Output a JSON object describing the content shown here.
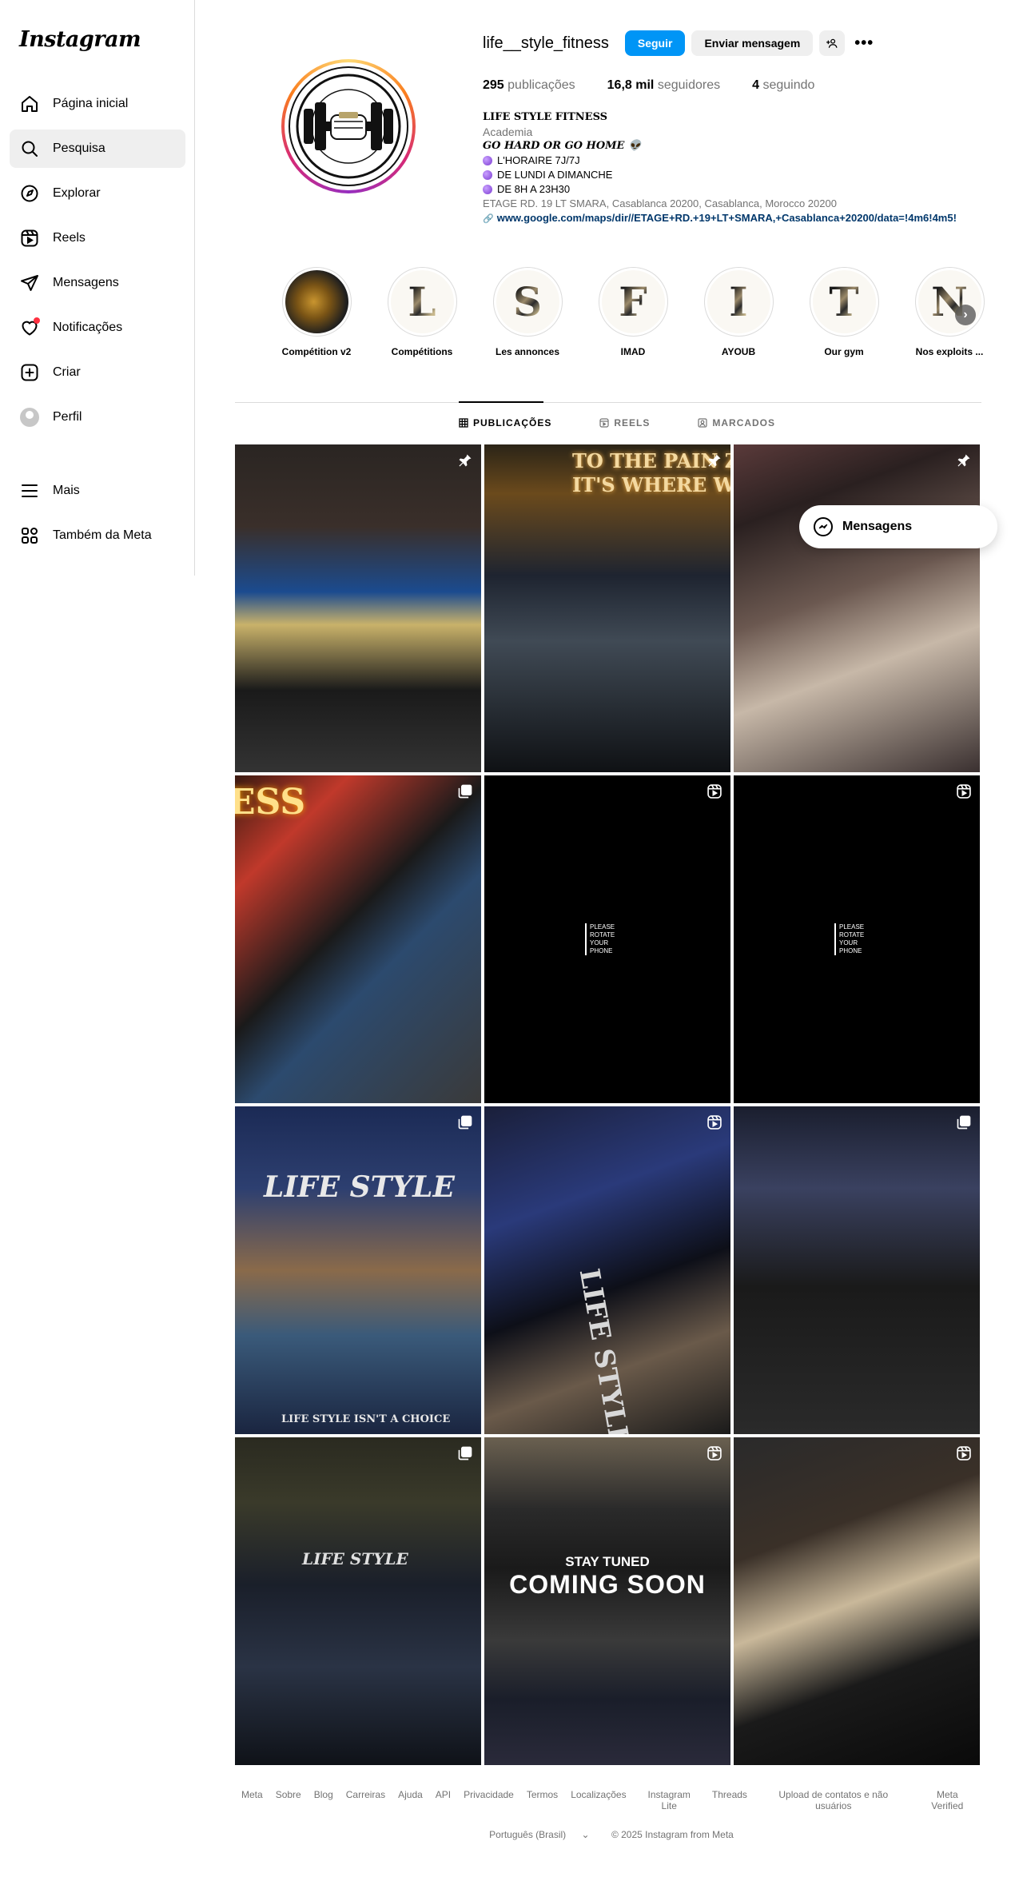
{
  "app": {
    "logo_text": "Instagram"
  },
  "sidebar": {
    "items": [
      {
        "label": "Página inicial",
        "icon": "home-icon"
      },
      {
        "label": "Pesquisa",
        "icon": "search-icon",
        "active": true
      },
      {
        "label": "Explorar",
        "icon": "compass-icon"
      },
      {
        "label": "Reels",
        "icon": "reels-icon"
      },
      {
        "label": "Mensagens",
        "icon": "direct-icon"
      },
      {
        "label": "Notificações",
        "icon": "heart-icon"
      },
      {
        "label": "Criar",
        "icon": "plus-square-icon"
      },
      {
        "label": "Perfil",
        "icon": "avatar"
      }
    ],
    "bottom_items": [
      {
        "label": "Mais",
        "icon": "menu-icon"
      },
      {
        "label": "Também da Meta",
        "icon": "meta-apps-icon"
      }
    ]
  },
  "profile": {
    "username": "life__style_fitness",
    "follow_button": "Seguir",
    "message_button": "Enviar mensagem",
    "stats": {
      "posts_value": "295",
      "posts_label": "publicações",
      "followers_value": "16,8 mil",
      "followers_label": "seguidores",
      "following_value": "4",
      "following_label": "seguindo"
    },
    "bio": {
      "name": "LIFE STYLE FITNESS",
      "category": "Academia",
      "line1": "GO HARD OR GO HOME 👽",
      "line2": "L'HORAIRE 7J/7J",
      "line3": "DE LUNDI A DIMANCHE",
      "line4": "DE 8H A 23H30",
      "address": "ETAGE RD. 19 LT SMARA, Casablanca 20200, Casablanca, Morocco 20200",
      "link": "www.google.com/maps/dir//ETAGE+RD.+19+LT+SMARA,+Casablanca+20200/data=!4m6!4m5!"
    }
  },
  "highlights": [
    {
      "label": "Compétition v2",
      "letter": ""
    },
    {
      "label": "Compétitions",
      "letter": "L"
    },
    {
      "label": "Les annonces",
      "letter": "S"
    },
    {
      "label": "IMAD",
      "letter": "F"
    },
    {
      "label": "AYOUB",
      "letter": "I"
    },
    {
      "label": "Our gym",
      "letter": "T"
    },
    {
      "label": "Nos exploits ...",
      "letter": "N"
    }
  ],
  "tabs": [
    {
      "label": "PUBLICAÇÕES",
      "icon": "grid-icon",
      "active": true
    },
    {
      "label": "REELS",
      "icon": "reels-icon"
    },
    {
      "label": "MARCADOS",
      "icon": "tagged-icon"
    }
  ],
  "posts": [
    {
      "type": "pinned"
    },
    {
      "type": "pinned",
      "neon1": "TO THE PAIN ZO",
      "neon2": "IT'S WHERE WE T"
    },
    {
      "type": "pinned"
    },
    {
      "type": "carousel",
      "neon": "ESS"
    },
    {
      "type": "reel",
      "overlay": "PLEASE ROTATE YOUR PHONE"
    },
    {
      "type": "reel",
      "overlay": "PLEASE ROTATE YOUR PHONE"
    },
    {
      "type": "carousel",
      "shirt_title": "LIFE STYLE",
      "shirt_footer": "LIFE STYLE ISN'T A CHOICE"
    },
    {
      "type": "reel",
      "shirt_title": "LIFE STYLE"
    },
    {
      "type": "carousel"
    },
    {
      "type": "carousel",
      "shirt_title": "LIFE STYLE"
    },
    {
      "type": "reel",
      "overlay_small": "STAY TUNED",
      "overlay_big": "COMING SOON"
    },
    {
      "type": "reel"
    }
  ],
  "floating": {
    "messages_label": "Mensagens"
  },
  "footer": {
    "links": [
      "Meta",
      "Sobre",
      "Blog",
      "Carreiras",
      "Ajuda",
      "API",
      "Privacidade",
      "Termos",
      "Localizações",
      "Instagram Lite",
      "Threads",
      "Upload de contatos e não usuários",
      "Meta Verified"
    ],
    "language": "Português (Brasil)",
    "copyright": "© 2025 Instagram from Meta"
  },
  "colors": {
    "primary": "#0095f6",
    "secondary": "#efefef",
    "muted": "#737373",
    "link": "#00376b",
    "notification": "#ff3040"
  }
}
